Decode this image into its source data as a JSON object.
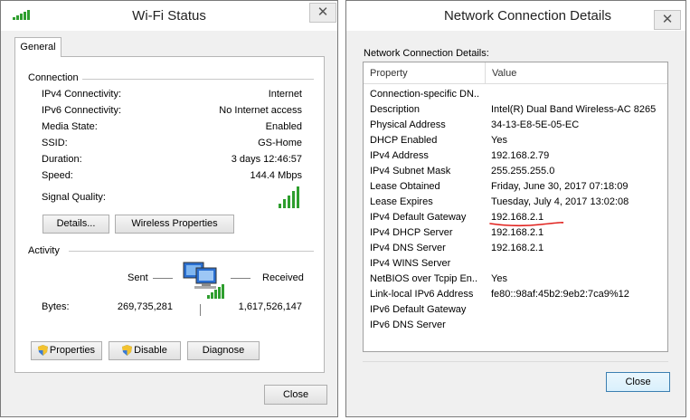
{
  "wifi_status": {
    "title": "Wi-Fi Status",
    "close_glyph": "✕",
    "tab_label": "General",
    "connection": {
      "group_label": "Connection",
      "rows": [
        {
          "label": "IPv4 Connectivity:",
          "value": "Internet"
        },
        {
          "label": "IPv6 Connectivity:",
          "value": "No Internet access"
        },
        {
          "label": "Media State:",
          "value": "Enabled"
        },
        {
          "label": "SSID:",
          "value": "GS-Home"
        },
        {
          "label": "Duration:",
          "value": "3 days 12:46:57"
        },
        {
          "label": "Speed:",
          "value": "144.4 Mbps"
        }
      ],
      "signal_label": "Signal Quality:",
      "details_button": "Details...",
      "wireless_properties_button": "Wireless Properties"
    },
    "activity": {
      "group_label": "Activity",
      "sent_label": "Sent",
      "received_label": "Received",
      "bytes_label": "Bytes:",
      "bytes_sent": "269,735,281",
      "bytes_received": "1,617,526,147"
    },
    "properties_button": "Properties",
    "disable_button": "Disable",
    "diagnose_button": "Diagnose",
    "close_button": "Close"
  },
  "details": {
    "title": "Network Connection Details",
    "close_glyph": "✕",
    "section_label": "Network Connection Details:",
    "col_property": "Property",
    "col_value": "Value",
    "rows": [
      {
        "property": "Connection-specific DN...",
        "value": ""
      },
      {
        "property": "Description",
        "value": "Intel(R) Dual Band Wireless-AC 8265"
      },
      {
        "property": "Physical Address",
        "value": "34-13-E8-5E-05-EC"
      },
      {
        "property": "DHCP Enabled",
        "value": "Yes"
      },
      {
        "property": "IPv4 Address",
        "value": "192.168.2.79"
      },
      {
        "property": "IPv4 Subnet Mask",
        "value": "255.255.255.0"
      },
      {
        "property": "Lease Obtained",
        "value": "Friday, June 30, 2017 07:18:09"
      },
      {
        "property": "Lease Expires",
        "value": "Tuesday, July 4, 2017 13:02:08"
      },
      {
        "property": "IPv4 Default Gateway",
        "value": "192.168.2.1"
      },
      {
        "property": "IPv4 DHCP Server",
        "value": "192.168.2.1"
      },
      {
        "property": "IPv4 DNS Server",
        "value": "192.168.2.1"
      },
      {
        "property": "IPv4 WINS Server",
        "value": ""
      },
      {
        "property": "NetBIOS over Tcpip En...",
        "value": "Yes"
      },
      {
        "property": "Link-local IPv6 Address",
        "value": "fe80::98af:45b2:9eb2:7ca9%12"
      },
      {
        "property": "IPv6 Default Gateway",
        "value": ""
      },
      {
        "property": "IPv6 DNS Server",
        "value": ""
      }
    ],
    "close_button": "Close",
    "annotation_color": "#e0201c"
  }
}
